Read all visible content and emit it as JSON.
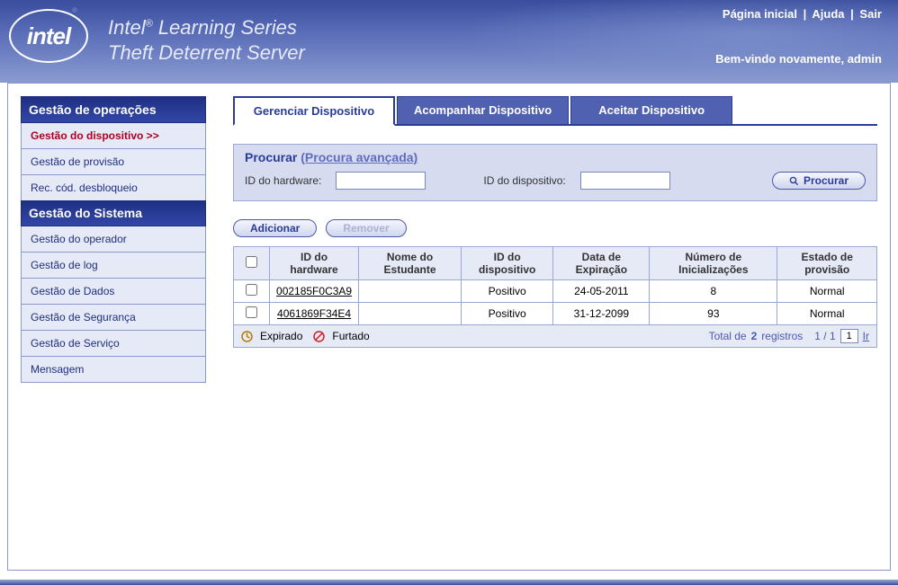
{
  "header": {
    "logo_text": "intel",
    "title_prefix": "Intel",
    "title_reg": "®",
    "title_suffix": " Learning Series",
    "subtitle": "Theft Deterrent Server",
    "links": {
      "home": "Página inicial",
      "help": "Ajuda",
      "exit": "Sair"
    },
    "welcome_prefix": "Bem-vindo novamente,  ",
    "welcome_user": "admin"
  },
  "sidebar": {
    "sections": [
      {
        "title": "Gestão de operações",
        "items": [
          {
            "label": "Gestão do dispositivo  >>",
            "active": true
          },
          {
            "label": "Gestão de provisão",
            "active": false
          },
          {
            "label": "Rec. cód. desbloqueio",
            "active": false
          }
        ]
      },
      {
        "title": "Gestão do Sistema",
        "items": [
          {
            "label": "Gestão do operador",
            "active": false
          },
          {
            "label": "Gestão de log",
            "active": false
          },
          {
            "label": "Gestão de Dados",
            "active": false
          },
          {
            "label": "Gestão de Segurança",
            "active": false
          },
          {
            "label": "Gestão de Serviço",
            "active": false
          },
          {
            "label": "Mensagem",
            "active": false
          }
        ]
      }
    ]
  },
  "tabs": [
    {
      "label": "Gerenciar Dispositivo",
      "active": true
    },
    {
      "label": "Acompanhar Dispositivo",
      "active": false
    },
    {
      "label": "Aceitar Dispositivo",
      "active": false
    }
  ],
  "search": {
    "title": "Procurar ",
    "advanced_link": "(Procura avançada)",
    "hw_id_label": "ID do hardware:",
    "hw_id_value": "",
    "dev_id_label": "ID do dispositivo:",
    "dev_id_value": "",
    "search_button": "Procurar"
  },
  "actions": {
    "add": "Adicionar",
    "remove": "Remover"
  },
  "table": {
    "columns": [
      "",
      "ID do hardware",
      "Nome do Estudante",
      "ID do dispositivo",
      "Data de Expiração",
      "Número de Inicializações",
      "Estado de provisão"
    ],
    "rows": [
      {
        "hw_id": "002185F0C3A9",
        "student": "",
        "dev_id": "Positivo",
        "exp": "24-05-2011",
        "boots": "8",
        "state": "Normal"
      },
      {
        "hw_id": "4061869F34E4",
        "student": "",
        "dev_id": "Positivo",
        "exp": "31-12-2099",
        "boots": "93",
        "state": "Normal"
      }
    ]
  },
  "footer": {
    "legend_expired": "Expirado",
    "legend_stolen": "Furtado",
    "total_prefix": "Total de ",
    "total_count": "2",
    "total_suffix": " registros",
    "page_info": "1 / 1",
    "page_input": "1",
    "go_label": "Ir"
  }
}
